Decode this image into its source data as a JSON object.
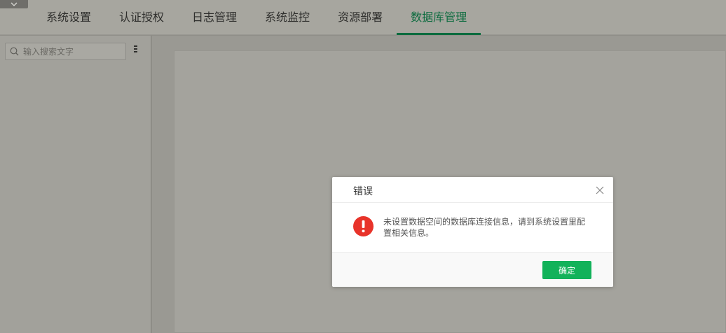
{
  "nav": {
    "tabs": [
      {
        "label": "系统设置"
      },
      {
        "label": "认证授权"
      },
      {
        "label": "日志管理"
      },
      {
        "label": "系统监控"
      },
      {
        "label": "资源部署"
      },
      {
        "label": "数据库管理"
      }
    ],
    "active_tab_index": 5
  },
  "sidebar": {
    "search": {
      "placeholder": "输入搜索文字",
      "value": ""
    }
  },
  "dialog": {
    "title": "错误",
    "message": "未设置数据空间的数据库连接信息，请到系统设置里配置相关信息。",
    "ok_label": "确定"
  },
  "icons": {
    "collapse": "chevron-down-icon",
    "search": "search-icon",
    "more": "more-menu-icon",
    "close": "close-icon",
    "error": "error-icon"
  },
  "colors": {
    "accent": "#0b6b3e",
    "button": "#12b25a",
    "error": "#e8332a"
  }
}
